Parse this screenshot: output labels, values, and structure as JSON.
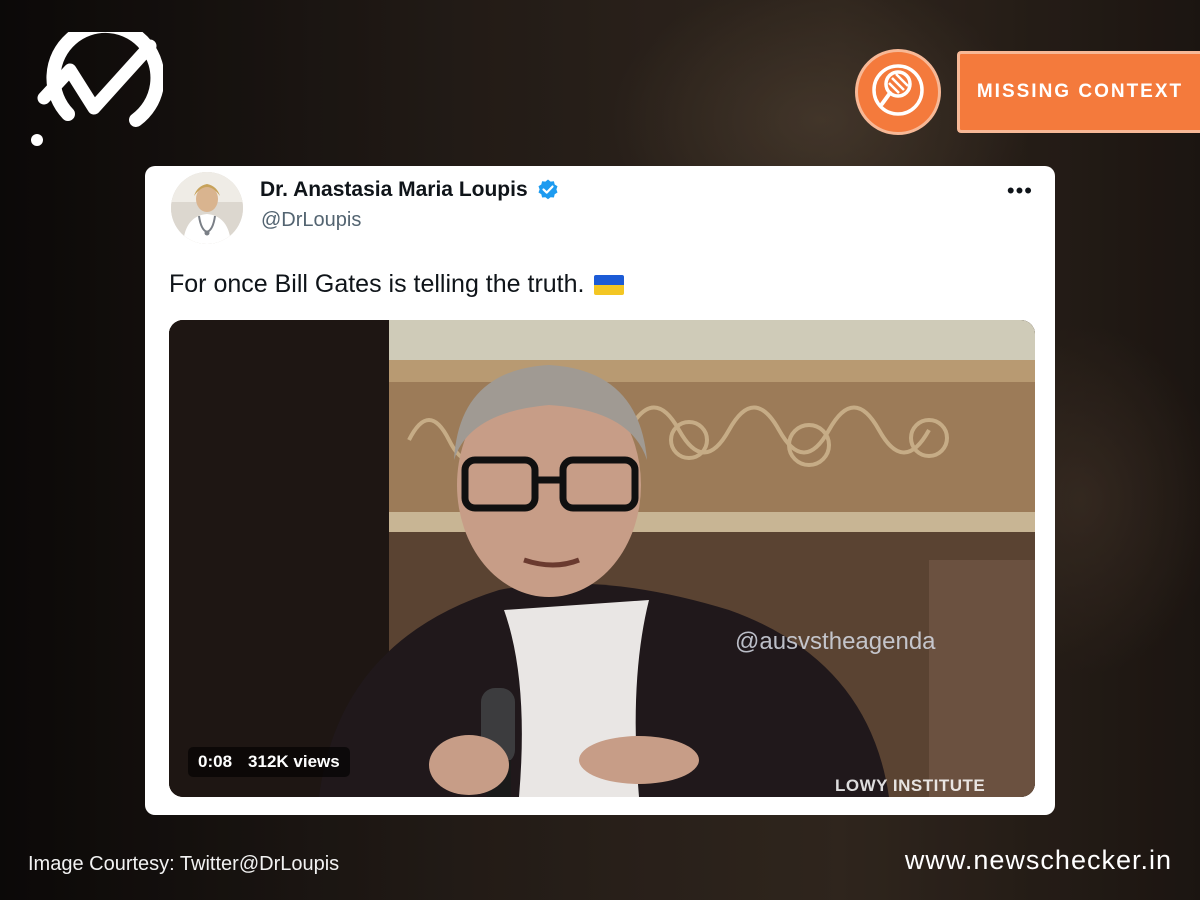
{
  "brand": {
    "logo_icon": "newschecker-check-icon",
    "site_url": "www.newschecker.in"
  },
  "verdict": {
    "label": "MISSING CONTEXT",
    "badge_icon": "fact-check-magnifier-icon",
    "color": "#f47a3c"
  },
  "tweet": {
    "author_name": "Dr. Anastasia Maria Loupis",
    "handle": "@DrLoupis",
    "verified_icon": "verified-badge-icon",
    "more_label": "•••",
    "text": "For once Bill Gates is telling the truth.",
    "flag_icon": "ukraine-flag-icon",
    "video": {
      "duration": "0:08",
      "views": "312K views",
      "watermark": "@ausvstheagenda",
      "institute_caption": "LOWY INSTITUTE"
    }
  },
  "credit": "Image Courtesy: Twitter@DrLoupis"
}
